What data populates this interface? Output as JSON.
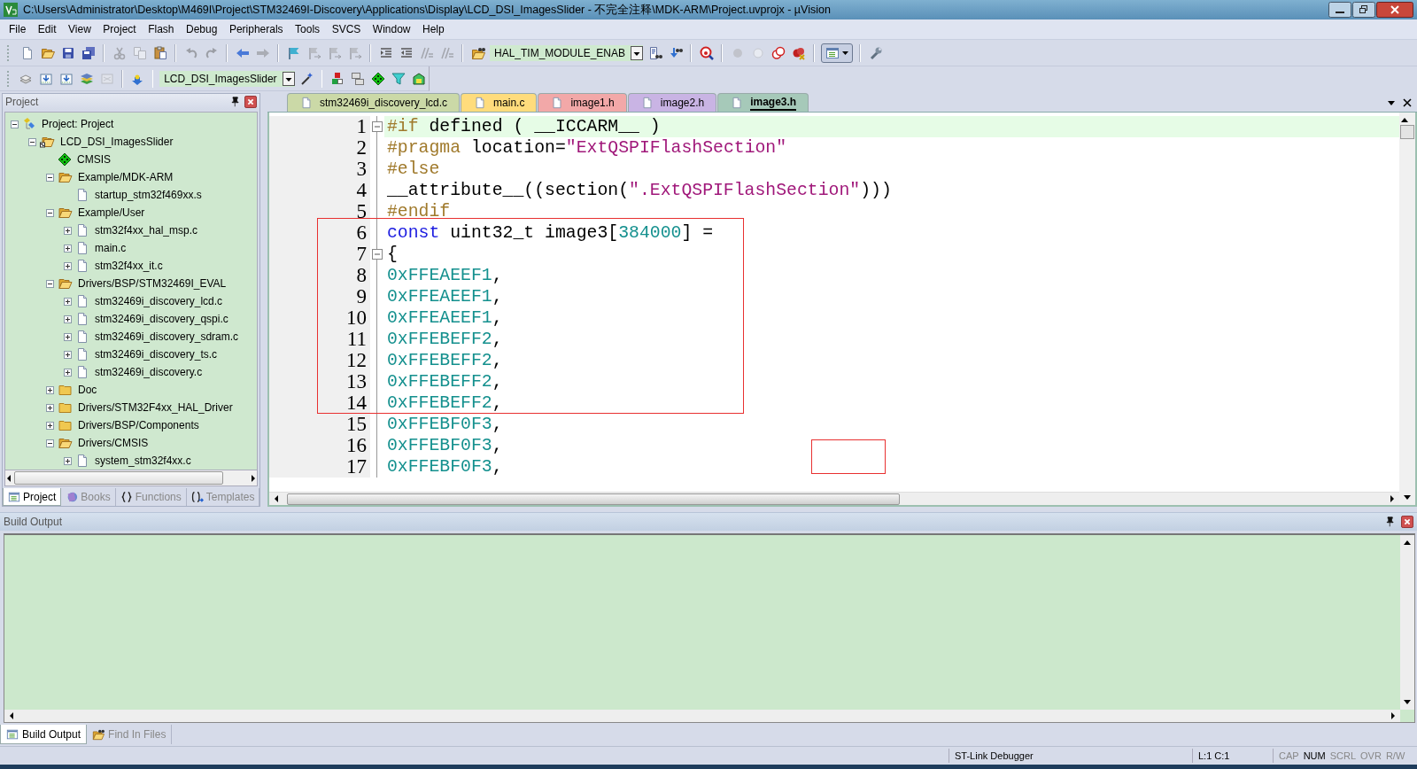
{
  "window": {
    "title": "C:\\Users\\Administrator\\Desktop\\M469I\\Project\\STM32469I-Discovery\\Applications\\Display\\LCD_DSI_ImagesSlider - 不完全注释\\MDK-ARM\\Project.uvprojx - µVision"
  },
  "menu": [
    "File",
    "Edit",
    "View",
    "Project",
    "Flash",
    "Debug",
    "Peripherals",
    "Tools",
    "SVCS",
    "Window",
    "Help"
  ],
  "toolbars": [
    {
      "items": [
        {
          "kind": "icon",
          "disabled": false
        },
        {
          "kind": "icon",
          "disabled": false
        },
        {
          "kind": "icon",
          "disabled": false
        },
        {
          "kind": "icon",
          "disabled": false
        },
        {
          "kind": "separator"
        },
        {
          "kind": "icon",
          "disabled": true
        },
        {
          "kind": "icon",
          "disabled": true
        },
        {
          "kind": "icon",
          "disabled": false
        },
        {
          "kind": "separator"
        },
        {
          "kind": "icon",
          "disabled": true
        },
        {
          "kind": "icon",
          "disabled": true
        },
        {
          "kind": "separator"
        },
        {
          "kind": "icon",
          "disabled": false
        },
        {
          "kind": "icon",
          "disabled": true
        },
        {
          "kind": "separator"
        },
        {
          "kind": "icon",
          "disabled": false
        },
        {
          "kind": "icon",
          "disabled": true
        },
        {
          "kind": "icon",
          "disabled": true
        },
        {
          "kind": "icon",
          "disabled": true
        },
        {
          "kind": "separator"
        },
        {
          "kind": "icon",
          "disabled": false
        },
        {
          "kind": "icon",
          "disabled": false
        },
        {
          "kind": "icon",
          "disabled": true
        },
        {
          "kind": "icon",
          "disabled": true
        },
        {
          "kind": "separator"
        },
        {
          "kind": "icon",
          "disabled": false
        },
        {
          "kind": "combo",
          "value": "HAL_TIM_MODULE_ENAB"
        },
        {
          "kind": "icon",
          "disabled": false
        },
        {
          "kind": "icon",
          "disabled": false
        },
        {
          "kind": "separator"
        },
        {
          "kind": "icon",
          "disabled": false
        },
        {
          "kind": "separator"
        },
        {
          "kind": "icon",
          "disabled": true
        },
        {
          "kind": "icon",
          "disabled": true
        },
        {
          "kind": "icon",
          "disabled": false
        },
        {
          "kind": "icon",
          "disabled": false
        },
        {
          "kind": "separator"
        },
        {
          "kind": "dropdown",
          "disabled": false
        },
        {
          "kind": "separator"
        },
        {
          "kind": "icon",
          "disabled": false
        }
      ]
    },
    {
      "items": [
        {
          "kind": "icon",
          "disabled": false
        },
        {
          "kind": "icon",
          "disabled": false
        },
        {
          "kind": "icon",
          "disabled": false
        },
        {
          "kind": "icon",
          "disabled": false
        },
        {
          "kind": "icon",
          "disabled": true
        },
        {
          "kind": "separator"
        },
        {
          "kind": "icon",
          "disabled": false
        },
        {
          "kind": "separator"
        },
        {
          "kind": "combo",
          "value": "LCD_DSI_ImagesSlider"
        },
        {
          "kind": "icon",
          "disabled": false
        },
        {
          "kind": "separator"
        },
        {
          "kind": "icon",
          "disabled": false
        },
        {
          "kind": "icon",
          "disabled": false
        },
        {
          "kind": "icon",
          "disabled": false
        },
        {
          "kind": "icon",
          "disabled": false
        },
        {
          "kind": "icon",
          "disabled": false
        }
      ]
    }
  ],
  "project_panel": {
    "title": "Project",
    "tree": [
      {
        "label": "Project: Project",
        "kind": "project",
        "expandable": true,
        "expanded": true,
        "children": [
          {
            "label": "LCD_DSI_ImagesSlider",
            "kind": "target",
            "expandable": true,
            "expanded": true,
            "children": [
              {
                "label": "CMSIS",
                "kind": "component",
                "expandable": false
              },
              {
                "label": "Example/MDK-ARM",
                "kind": "folder",
                "expandable": true,
                "expanded": true,
                "children": [
                  {
                    "label": "startup_stm32f469xx.s",
                    "kind": "file",
                    "expandable": false
                  }
                ]
              },
              {
                "label": "Example/User",
                "kind": "folder",
                "expandable": true,
                "expanded": true,
                "children": [
                  {
                    "label": "stm32f4xx_hal_msp.c",
                    "kind": "file",
                    "expandable": true,
                    "expanded": false
                  },
                  {
                    "label": "main.c",
                    "kind": "file",
                    "expandable": true,
                    "expanded": false
                  },
                  {
                    "label": "stm32f4xx_it.c",
                    "kind": "file",
                    "expandable": true,
                    "expanded": false
                  }
                ]
              },
              {
                "label": "Drivers/BSP/STM32469I_EVAL",
                "kind": "folder",
                "expandable": true,
                "expanded": true,
                "children": [
                  {
                    "label": "stm32469i_discovery_lcd.c",
                    "kind": "file",
                    "expandable": true,
                    "expanded": false
                  },
                  {
                    "label": "stm32469i_discovery_qspi.c",
                    "kind": "file",
                    "expandable": true,
                    "expanded": false
                  },
                  {
                    "label": "stm32469i_discovery_sdram.c",
                    "kind": "file",
                    "expandable": true,
                    "expanded": false
                  },
                  {
                    "label": "stm32469i_discovery_ts.c",
                    "kind": "file",
                    "expandable": true,
                    "expanded": false
                  },
                  {
                    "label": "stm32469i_discovery.c",
                    "kind": "file",
                    "expandable": true,
                    "expanded": false
                  }
                ]
              },
              {
                "label": "Doc",
                "kind": "folder",
                "expandable": true,
                "expanded": false
              },
              {
                "label": "Drivers/STM32F4xx_HAL_Driver",
                "kind": "folder",
                "expandable": true,
                "expanded": false
              },
              {
                "label": "Drivers/BSP/Components",
                "kind": "folder",
                "expandable": true,
                "expanded": false
              },
              {
                "label": "Drivers/CMSIS",
                "kind": "folder",
                "expandable": true,
                "expanded": true,
                "children": [
                  {
                    "label": "system_stm32f4xx.c",
                    "kind": "file",
                    "expandable": true,
                    "expanded": false
                  }
                ]
              }
            ]
          }
        ]
      }
    ],
    "tabs": [
      {
        "label": "Project",
        "selected": true
      },
      {
        "label": "Books",
        "selected": false
      },
      {
        "label": "Functions",
        "selected": false
      },
      {
        "label": "Templates",
        "selected": false
      }
    ]
  },
  "editor": {
    "tabs": [
      {
        "label": "stm32469i_discovery_lcd.c",
        "color": "#cbd9a7",
        "selected": false
      },
      {
        "label": "main.c",
        "color": "#ffdc7c",
        "selected": false
      },
      {
        "label": "image1.h",
        "color": "#f2a8a8",
        "selected": false
      },
      {
        "label": "image2.h",
        "color": "#c9b4e4",
        "selected": false
      },
      {
        "label": "image3.h",
        "color": "#a6c9b9",
        "selected": true
      }
    ],
    "lines": [
      {
        "number": "1",
        "current": true,
        "foldable": true,
        "tokens": [
          {
            "kind": "preprocessor",
            "text": "#if"
          },
          {
            "kind": "plain",
            "text": " defined ( __ICCARM__ )"
          }
        ]
      },
      {
        "number": "2",
        "current": false,
        "foldable": false,
        "tokens": [
          {
            "kind": "preprocessor",
            "text": "#pragma"
          },
          {
            "kind": "plain",
            "text": " location="
          },
          {
            "kind": "string",
            "text": "\"ExtQSPIFlashSection\""
          }
        ]
      },
      {
        "number": "3",
        "current": false,
        "foldable": false,
        "tokens": [
          {
            "kind": "preprocessor",
            "text": "#else"
          }
        ]
      },
      {
        "number": "4",
        "current": false,
        "foldable": false,
        "tokens": [
          {
            "kind": "plain",
            "text": "__attribute__((section("
          },
          {
            "kind": "string",
            "text": "\".ExtQSPIFlashSection\""
          },
          {
            "kind": "plain",
            "text": ")))"
          }
        ]
      },
      {
        "number": "5",
        "current": false,
        "foldable": false,
        "tokens": [
          {
            "kind": "preprocessor",
            "text": "#endif"
          }
        ]
      },
      {
        "number": "6",
        "current": false,
        "foldable": false,
        "tokens": [
          {
            "kind": "keyword",
            "text": "const"
          },
          {
            "kind": "plain",
            "text": " uint32_t image3["
          },
          {
            "kind": "number",
            "text": "384000"
          },
          {
            "kind": "plain",
            "text": "] ="
          }
        ]
      },
      {
        "number": "7",
        "current": false,
        "foldable": true,
        "tokens": [
          {
            "kind": "plain",
            "text": "{"
          }
        ]
      },
      {
        "number": "8",
        "current": false,
        "foldable": false,
        "tokens": [
          {
            "kind": "number",
            "text": "0xFFEAEEF1"
          },
          {
            "kind": "plain",
            "text": ","
          }
        ]
      },
      {
        "number": "9",
        "current": false,
        "foldable": false,
        "tokens": [
          {
            "kind": "number",
            "text": "0xFFEAEEF1"
          },
          {
            "kind": "plain",
            "text": ","
          }
        ]
      },
      {
        "number": "10",
        "current": false,
        "foldable": false,
        "tokens": [
          {
            "kind": "number",
            "text": "0xFFEAEEF1"
          },
          {
            "kind": "plain",
            "text": ","
          }
        ]
      },
      {
        "number": "11",
        "current": false,
        "foldable": false,
        "tokens": [
          {
            "kind": "number",
            "text": "0xFFEBEFF2"
          },
          {
            "kind": "plain",
            "text": ","
          }
        ]
      },
      {
        "number": "12",
        "current": false,
        "foldable": false,
        "tokens": [
          {
            "kind": "number",
            "text": "0xFFEBEFF2"
          },
          {
            "kind": "plain",
            "text": ","
          }
        ]
      },
      {
        "number": "13",
        "current": false,
        "foldable": false,
        "tokens": [
          {
            "kind": "number",
            "text": "0xFFEBEFF2"
          },
          {
            "kind": "plain",
            "text": ","
          }
        ]
      },
      {
        "number": "14",
        "current": false,
        "foldable": false,
        "tokens": [
          {
            "kind": "number",
            "text": "0xFFEBEFF2"
          },
          {
            "kind": "plain",
            "text": ","
          }
        ]
      },
      {
        "number": "15",
        "current": false,
        "foldable": false,
        "tokens": [
          {
            "kind": "number",
            "text": "0xFFEBF0F3"
          },
          {
            "kind": "plain",
            "text": ","
          }
        ]
      },
      {
        "number": "16",
        "current": false,
        "foldable": false,
        "tokens": [
          {
            "kind": "number",
            "text": "0xFFEBF0F3"
          },
          {
            "kind": "plain",
            "text": ","
          }
        ]
      },
      {
        "number": "17",
        "current": false,
        "foldable": false,
        "tokens": [
          {
            "kind": "number",
            "text": "0xFFEBF0F3"
          },
          {
            "kind": "plain",
            "text": ","
          }
        ]
      }
    ]
  },
  "build_output": {
    "title": "Build Output",
    "tabs": [
      {
        "label": "Build Output",
        "selected": true
      },
      {
        "label": "Find In Files",
        "selected": false
      }
    ]
  },
  "status_bar": {
    "debugger": "ST-Link Debugger",
    "position": "L:1 C:1",
    "indicators": [
      {
        "text": "CAP",
        "on": false
      },
      {
        "text": "NUM",
        "on": true
      },
      {
        "text": "SCRL",
        "on": false
      },
      {
        "text": "OVR",
        "on": false
      },
      {
        "text": "R/W",
        "on": false
      }
    ]
  }
}
